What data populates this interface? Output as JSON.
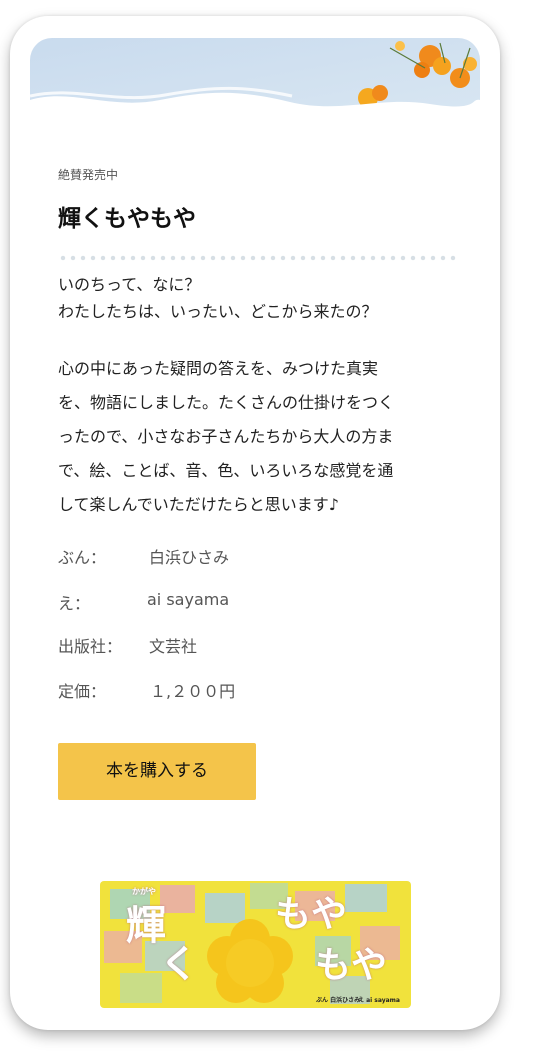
{
  "header": {
    "eyebrow": "絶賛発売中",
    "title": "輝くもやもや"
  },
  "lead": {
    "line1": "いのちって、なに？",
    "line2": "わたしたちは、いったい、どこから来たの？"
  },
  "description": {
    "line1": "心の中にあった疑問の答えを、みつけた真実",
    "line2": "を、物語にしました。たくさんの仕掛けをつく",
    "line3": "ったので、小さなお子さんたちから大人の方ま",
    "line4": "で、絵、ことば、音、色、いろいろな感覚を通",
    "line5": "して楽しんでいただけたらと思います♪"
  },
  "details": {
    "author_label": "ぶん：",
    "author_value": "白浜ひさみ",
    "illustrator_label": "え：",
    "illustrator_value": "ai sayama",
    "publisher_label": "出版社：",
    "publisher_value": "文芸社",
    "price_label": "定価：",
    "price_value": "１,２００円"
  },
  "buy_button": {
    "label": "本を購入する"
  },
  "cover": {
    "ruby": "かがや",
    "title_kanji": "輝",
    "title_ku": "く",
    "title_moya1": "もや",
    "title_moya2": "もや",
    "credit_author": "ぶん 白浜ひさみ",
    "credit_illustrator": "え ai sayama"
  },
  "colors": {
    "accent": "#f4c44a",
    "dots": "#d7dfe5",
    "text": "#222222",
    "muted": "#555555"
  }
}
